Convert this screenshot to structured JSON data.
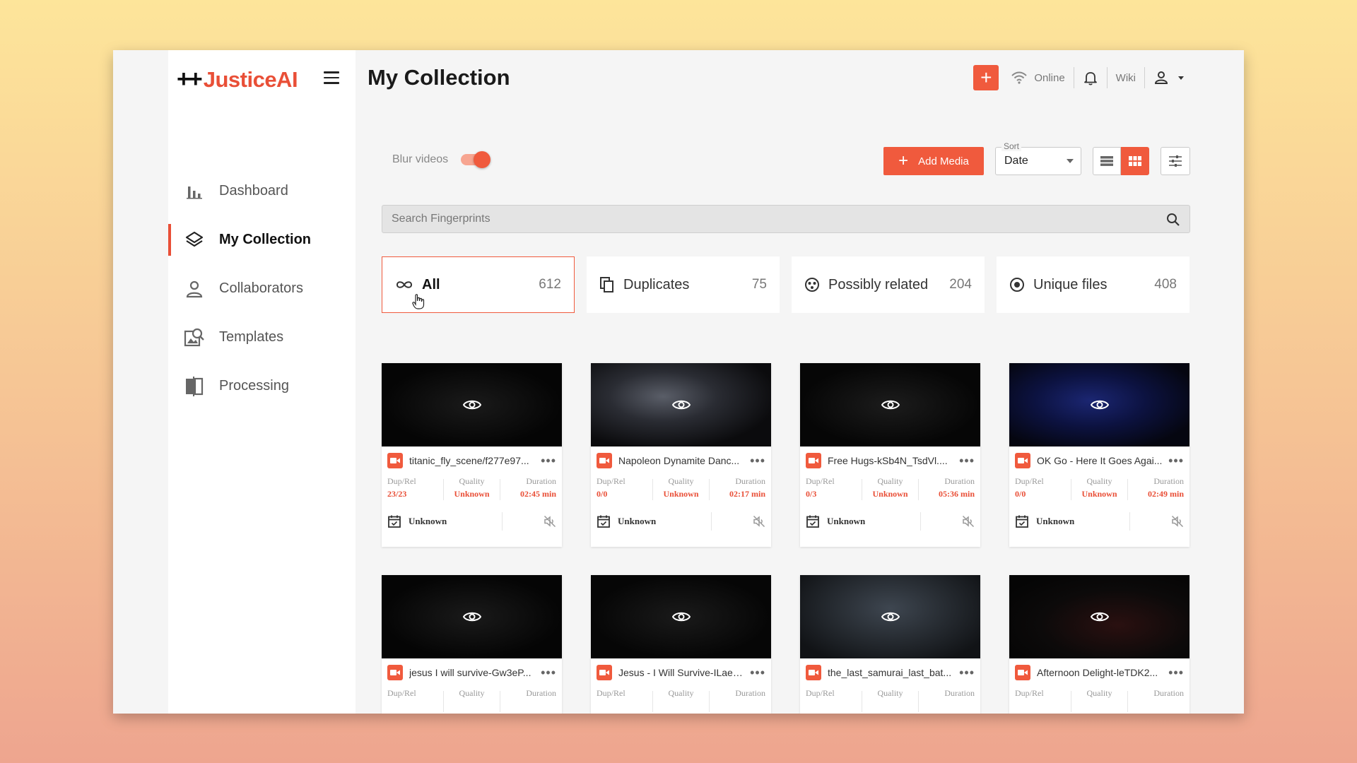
{
  "app": {
    "logo_plus": "++",
    "logo_text": "JusticeAI"
  },
  "header": {
    "title": "My Collection",
    "status": "Online",
    "wiki": "Wiki"
  },
  "sidebar": {
    "items": [
      {
        "label": "Dashboard",
        "icon": "bar-chart-icon",
        "active": false
      },
      {
        "label": "My Collection",
        "icon": "layers-icon",
        "active": true
      },
      {
        "label": "Collaborators",
        "icon": "person-icon",
        "active": false
      },
      {
        "label": "Templates",
        "icon": "templates-icon",
        "active": false
      },
      {
        "label": "Processing",
        "icon": "processing-icon",
        "active": false
      }
    ]
  },
  "controls": {
    "blur_label": "Blur videos",
    "blur_on": true,
    "add_media": "Add Media",
    "sort_label": "Sort",
    "sort_value": "Date",
    "view_mode": "grid"
  },
  "search": {
    "placeholder": "Search Fingerprints"
  },
  "filters": [
    {
      "label": "All",
      "count": "612",
      "icon": "infinity-icon",
      "active": true
    },
    {
      "label": "Duplicates",
      "count": "75",
      "icon": "copy-icon",
      "active": false
    },
    {
      "label": "Possibly related",
      "count": "204",
      "icon": "related-icon",
      "active": false
    },
    {
      "label": "Unique files",
      "count": "408",
      "icon": "target-icon",
      "active": false
    }
  ],
  "meta_labels": {
    "dup": "Dup/Rel",
    "quality": "Quality",
    "duration": "Duration"
  },
  "videos": [
    {
      "title": "titanic_fly_scene/f277e97...",
      "dup": "23/23",
      "quality": "Unknown",
      "duration": "02:45 min",
      "date": "Unknown"
    },
    {
      "title": "Napoleon Dynamite Danc...",
      "dup": "0/0",
      "quality": "Unknown",
      "duration": "02:17 min",
      "date": "Unknown"
    },
    {
      "title": "Free Hugs-kSb4N_TsdVl....",
      "dup": "0/3",
      "quality": "Unknown",
      "duration": "05:36 min",
      "date": "Unknown"
    },
    {
      "title": "OK Go - Here It Goes Agai...",
      "dup": "0/0",
      "quality": "Unknown",
      "duration": "02:49 min",
      "date": "Unknown"
    },
    {
      "title": "jesus I will survive-Gw3eP...",
      "dup": "",
      "quality": "",
      "duration": "",
      "date": ""
    },
    {
      "title": "Jesus - I Will Survive-ILaeL...",
      "dup": "",
      "quality": "",
      "duration": "",
      "date": ""
    },
    {
      "title": "the_last_samurai_last_bat...",
      "dup": "",
      "quality": "",
      "duration": "",
      "date": ""
    },
    {
      "title": "Afternoon Delight-leTDK2...",
      "dup": "",
      "quality": "",
      "duration": "",
      "date": ""
    }
  ],
  "colors": {
    "accent": "#f05a3d",
    "accent_text": "#e94f37"
  }
}
